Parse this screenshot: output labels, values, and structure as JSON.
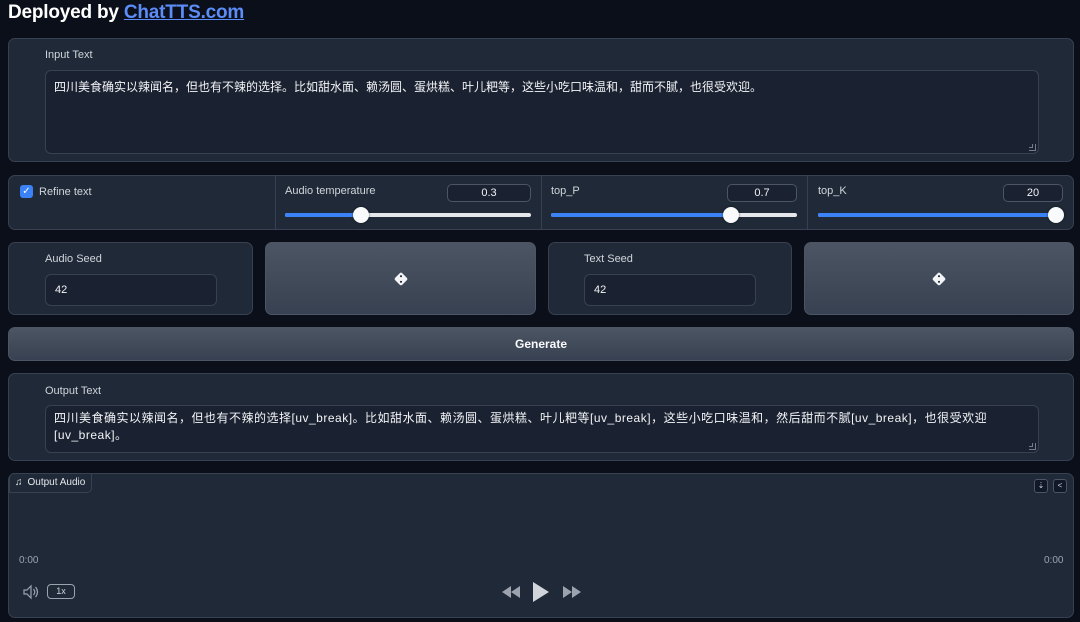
{
  "header": {
    "prefix": "Deployed by ",
    "link_text": "ChatTTS.com"
  },
  "input": {
    "label": "Input Text",
    "value": "四川美食确实以辣闻名，但也有不辣的选择。比如甜水面、赖汤圆、蛋烘糕、叶儿粑等，这些小吃口味温和，甜而不腻，也很受欢迎。"
  },
  "controls": {
    "refine_label": "Refine text",
    "refine_checked": true,
    "audio_temperature": {
      "label": "Audio temperature",
      "value": "0.3",
      "fraction": 0.31
    },
    "top_p": {
      "label": "top_P",
      "value": "0.7",
      "fraction": 0.73
    },
    "top_k": {
      "label": "top_K",
      "value": "20",
      "fraction": 1.0
    },
    "accent_color": "#3b82f6"
  },
  "seeds": {
    "audio": {
      "label": "Audio Seed",
      "value": "42"
    },
    "text": {
      "label": "Text Seed",
      "value": "42"
    },
    "dice_icon": "dice-icon"
  },
  "generate": {
    "label": "Generate"
  },
  "output": {
    "label": "Output Text",
    "value": "四川美食确实以辣闻名，但也有不辣的选择[uv_break]。比如甜水面、赖汤圆、蛋烘糕、叶儿粑等[uv_break]，这些小吃口味温和，然后甜而不腻[uv_break]，也很受欢迎[uv_break]。"
  },
  "audio": {
    "tag_icon": "music-note-icon",
    "tag_label": "Output Audio",
    "current_time": "0:00",
    "duration": "0:00",
    "playback_rate": "1x",
    "icons": [
      "download-icon",
      "share-icon",
      "volume-icon",
      "rewind-icon",
      "play-icon",
      "fast-forward-icon"
    ]
  }
}
